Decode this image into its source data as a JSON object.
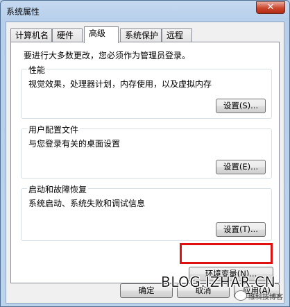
{
  "window": {
    "title": "系统属性",
    "close_glyph": "✕"
  },
  "tabs": [
    {
      "label": "计算机名",
      "active": false
    },
    {
      "label": "硬件",
      "active": false
    },
    {
      "label": "高级",
      "active": true
    },
    {
      "label": "系统保护",
      "active": false
    },
    {
      "label": "远程",
      "active": false
    }
  ],
  "notice": "要进行大多数更改，您必须作为管理员登录。",
  "groups": {
    "performance": {
      "title": "性能",
      "desc": "视觉效果，处理器计划，内存使用，以及虚拟内存",
      "button": "设置(S)..."
    },
    "profile": {
      "title": "用户配置文件",
      "desc": "与您登录有关的桌面设置",
      "button": "设置(E)..."
    },
    "startup": {
      "title": "启动和故障恢复",
      "desc": "系统启动、系统失败和调试信息",
      "button": "设置(T)..."
    }
  },
  "env_button": "环境变量(N)...",
  "footer": {
    "ok": "确定",
    "cancel": "取消",
    "apply": "应用(A)"
  },
  "watermark": "BLOG.IZHAR.CN",
  "wechat_caption": "维科技博客",
  "colors": {
    "highlight": "#e01010",
    "close_red": "#c9462c"
  }
}
